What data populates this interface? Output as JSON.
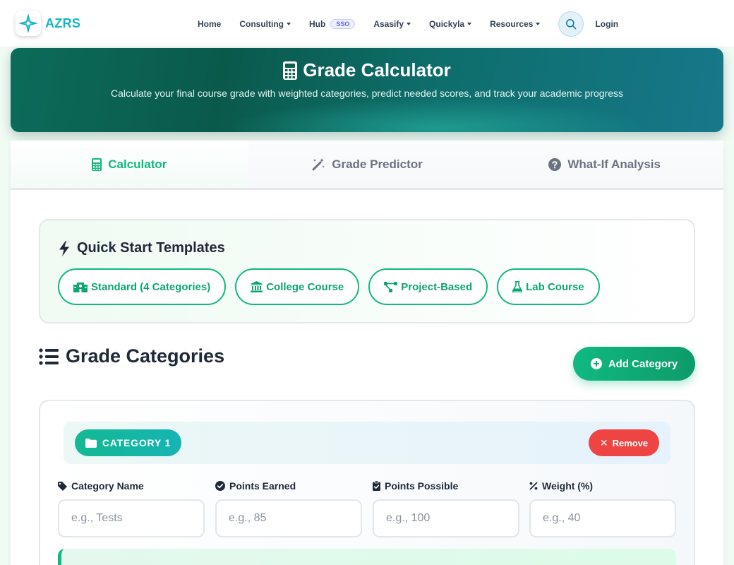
{
  "nav": {
    "brand": "AZRS",
    "links": [
      {
        "label": "Home",
        "dropdown": false
      },
      {
        "label": "Consulting",
        "dropdown": true
      },
      {
        "label": "Hub",
        "badge": "SSO",
        "dropdown": false
      },
      {
        "label": "Asasify",
        "dropdown": true
      },
      {
        "label": "Quickyla",
        "dropdown": true
      },
      {
        "label": "Resources",
        "dropdown": true
      }
    ],
    "search_icon": "search-icon",
    "login": "Login"
  },
  "hero": {
    "icon": "calculator-icon",
    "title": "Grade Calculator",
    "subtitle": "Calculate your final course grade with weighted categories, predict needed scores, and track your academic progress"
  },
  "tabs": [
    {
      "label": "Calculator",
      "icon": "calculator-icon",
      "active": true
    },
    {
      "label": "Grade Predictor",
      "icon": "magic-wand-icon",
      "active": false
    },
    {
      "label": "What-If Analysis",
      "icon": "question-circle-icon",
      "active": false
    }
  ],
  "templates": {
    "title": "Quick Start Templates",
    "icon": "bolt-icon",
    "items": [
      {
        "label": "Standard (4 Categories)",
        "icon": "school-icon"
      },
      {
        "label": "College Course",
        "icon": "university-icon"
      },
      {
        "label": "Project-Based",
        "icon": "project-diagram-icon"
      },
      {
        "label": "Lab Course",
        "icon": "flask-icon"
      }
    ]
  },
  "categories_section": {
    "title": "Grade Categories",
    "icon": "list-icon",
    "add_label": "Add Category"
  },
  "category": {
    "badge": "CATEGORY 1",
    "remove_label": "Remove",
    "fields": [
      {
        "label": "Category Name",
        "placeholder": "e.g., Tests",
        "value": "",
        "icon": "tag-icon"
      },
      {
        "label": "Points Earned",
        "placeholder": "e.g., 85",
        "value": "",
        "icon": "check-circle-icon"
      },
      {
        "label": "Points Possible",
        "placeholder": "e.g., 100",
        "value": "",
        "icon": "clipboard-check-icon"
      },
      {
        "label": "Weight (%)",
        "placeholder": "e.g., 40",
        "value": "",
        "icon": "percent-icon"
      }
    ]
  },
  "colors": {
    "accent": "#10b981",
    "brand": "#13b5c8",
    "danger": "#ef4444",
    "hero_start": "#0c6b5a",
    "hero_end": "#16788a"
  }
}
